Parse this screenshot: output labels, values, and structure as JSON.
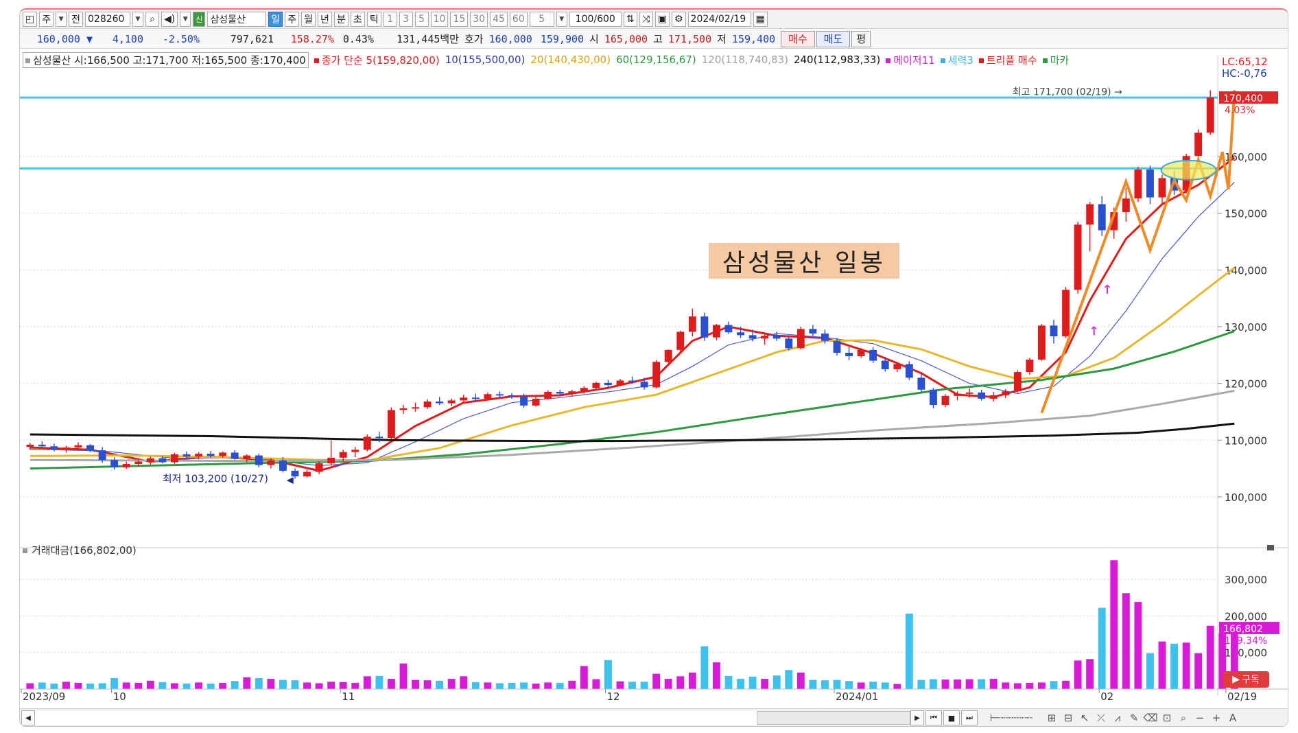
{
  "toolbar": {
    "type_label": "주",
    "prev_label": "전",
    "code": "028260",
    "new_badge": "신",
    "stock_name": "삼성물산",
    "periods": [
      "일",
      "주",
      "월",
      "년",
      "분",
      "초",
      "틱"
    ],
    "intervals": [
      "1",
      "3",
      "5",
      "10",
      "15",
      "30",
      "45",
      "60"
    ],
    "interval_value": "5",
    "count": "100/600",
    "date": "2024/02/19"
  },
  "pricebar": {
    "price": "160,000 ▼",
    "change": "4,100",
    "change_pct": "-2.50%",
    "volume": "797,621",
    "vol_ratio": "158.27%",
    "turnover": "0.43%",
    "amount": "131,445백만",
    "bid_label": "호가",
    "bid1": "160,000",
    "bid2": "159,900",
    "open_label": "시",
    "open": "165,000",
    "high_label": "고",
    "high": "171,500",
    "low_label": "저",
    "low": "159,400",
    "buy": "매수",
    "sell": "매도",
    "avg": "평"
  },
  "legend": {
    "stock": "삼성물산 시:166,500 고:171,700 저:165,500 종:170,400",
    "ma_title": "종가 단순 5(159,820,00)",
    "ma10": "10(155,500,00)",
    "ma20": "20(140,430,00)",
    "ma60": "60(129,156,67)",
    "ma120": "120(118,740,83)",
    "ma240": "240(112,983,33)",
    "major": "메이저11",
    "force": "세력3",
    "triple": "트리플 매수",
    "marker": "마카",
    "lc": "LC:65,12",
    "hc": "HC:-0,76"
  },
  "chart_data": {
    "type": "candlestick",
    "title": "삼성물산 일봉",
    "annotations": {
      "high": "최고 171,700 (02/19)",
      "low": "최저 103,200 (10/27)",
      "last_price": "170,400",
      "last_pct": "4.03%",
      "hlines": [
        170400,
        157900
      ]
    },
    "y_ticks": [
      "160,000",
      "150,000",
      "140,000",
      "130,000",
      "120,000",
      "110,000",
      "100,000"
    ],
    "y_tick_values": [
      160000,
      150000,
      140000,
      130000,
      120000,
      110000,
      100000
    ],
    "ylim": [
      92000,
      175500
    ],
    "x_labels": [
      "2023/09",
      "10",
      "11",
      "12",
      "2024/01",
      "02",
      "02/19"
    ],
    "x_label_index": [
      0,
      7,
      26,
      48,
      67,
      89,
      100
    ],
    "ohlc": [
      [
        108.8,
        109.5,
        108.3,
        109.2
      ],
      [
        109.2,
        109.8,
        108.8,
        108.9
      ],
      [
        108.9,
        109.4,
        108.0,
        108.4
      ],
      [
        108.4,
        109.0,
        107.8,
        108.7
      ],
      [
        108.7,
        109.6,
        108.2,
        109.1
      ],
      [
        109.1,
        109.3,
        107.9,
        108.2
      ],
      [
        108.2,
        108.8,
        106.0,
        106.5
      ],
      [
        106.5,
        107.0,
        104.8,
        105.2
      ],
      [
        105.2,
        106.2,
        104.9,
        105.8
      ],
      [
        105.8,
        106.6,
        105.3,
        106.2
      ],
      [
        106.2,
        107.1,
        105.7,
        106.8
      ],
      [
        106.8,
        107.2,
        105.9,
        106.1
      ],
      [
        106.1,
        107.8,
        105.8,
        107.5
      ],
      [
        107.5,
        108.0,
        106.8,
        107.1
      ],
      [
        107.1,
        107.9,
        106.6,
        107.6
      ],
      [
        107.6,
        108.1,
        106.9,
        107.2
      ],
      [
        107.2,
        108.0,
        106.9,
        107.8
      ],
      [
        107.8,
        108.2,
        106.5,
        106.7
      ],
      [
        106.7,
        107.5,
        106.1,
        107.3
      ],
      [
        107.3,
        107.6,
        105.2,
        105.6
      ],
      [
        105.6,
        106.8,
        105.0,
        106.4
      ],
      [
        106.4,
        107.0,
        104.3,
        104.6
      ],
      [
        104.6,
        105.0,
        103.2,
        103.6
      ],
      [
        103.6,
        104.8,
        103.4,
        104.4
      ],
      [
        104.4,
        106.3,
        104.0,
        105.9
      ],
      [
        105.9,
        110.0,
        105.5,
        106.9
      ],
      [
        106.9,
        108.3,
        106.2,
        107.9
      ],
      [
        107.9,
        108.8,
        107.0,
        108.3
      ],
      [
        108.3,
        111.0,
        108.0,
        110.6
      ],
      [
        110.6,
        111.5,
        109.6,
        110.4
      ],
      [
        110.4,
        115.8,
        110.1,
        115.3
      ],
      [
        115.3,
        116.2,
        114.6,
        115.6
      ],
      [
        115.6,
        116.6,
        115.0,
        115.8
      ],
      [
        115.8,
        117.2,
        115.5,
        116.8
      ],
      [
        116.8,
        117.6,
        116.2,
        116.5
      ],
      [
        116.5,
        117.3,
        116.0,
        117.0
      ],
      [
        117.0,
        118.0,
        116.7,
        117.5
      ],
      [
        117.5,
        118.2,
        116.9,
        117.3
      ],
      [
        117.3,
        118.4,
        117.0,
        118.1
      ],
      [
        118.1,
        118.6,
        117.4,
        117.9
      ],
      [
        117.9,
        118.3,
        117.3,
        117.7
      ],
      [
        117.7,
        118.2,
        115.7,
        116.1
      ],
      [
        116.1,
        117.6,
        115.9,
        117.3
      ],
      [
        117.3,
        118.8,
        117.1,
        118.5
      ],
      [
        118.5,
        118.9,
        117.8,
        118.2
      ],
      [
        118.2,
        118.9,
        117.7,
        118.6
      ],
      [
        118.6,
        119.5,
        118.2,
        119.2
      ],
      [
        119.2,
        120.3,
        118.8,
        120.1
      ],
      [
        120.1,
        120.6,
        119.3,
        119.7
      ],
      [
        119.7,
        120.8,
        119.5,
        120.5
      ],
      [
        120.5,
        121.2,
        119.9,
        120.3
      ],
      [
        120.3,
        121.0,
        118.9,
        119.3
      ],
      [
        119.3,
        124.1,
        119.1,
        123.8
      ],
      [
        123.8,
        126.0,
        123.5,
        125.9
      ],
      [
        125.9,
        129.3,
        125.6,
        129.1
      ],
      [
        129.1,
        133.2,
        128.3,
        131.8
      ],
      [
        131.8,
        132.5,
        127.5,
        128.1
      ],
      [
        128.1,
        130.5,
        127.6,
        130.3
      ],
      [
        130.3,
        130.9,
        128.7,
        129.0
      ],
      [
        129.0,
        130.0,
        128.0,
        128.5
      ],
      [
        128.5,
        129.5,
        127.4,
        127.9
      ],
      [
        127.9,
        129.0,
        126.8,
        128.4
      ],
      [
        128.4,
        129.1,
        127.5,
        127.9
      ],
      [
        127.9,
        128.5,
        125.8,
        126.2
      ],
      [
        126.2,
        130.0,
        126.0,
        129.6
      ],
      [
        129.6,
        130.3,
        128.4,
        128.8
      ],
      [
        128.8,
        129.5,
        127.0,
        127.5
      ],
      [
        127.5,
        128.0,
        124.9,
        125.4
      ],
      [
        125.4,
        126.5,
        124.1,
        124.8
      ],
      [
        124.8,
        126.2,
        124.5,
        125.9
      ],
      [
        125.9,
        126.4,
        123.6,
        124.0
      ],
      [
        124.0,
        124.7,
        122.1,
        122.5
      ],
      [
        122.5,
        123.8,
        122.0,
        123.4
      ],
      [
        123.4,
        123.9,
        120.6,
        121.0
      ],
      [
        121.0,
        121.8,
        118.4,
        118.9
      ],
      [
        118.9,
        119.2,
        115.6,
        116.2
      ],
      [
        116.2,
        118.1,
        115.8,
        117.8
      ],
      [
        117.8,
        118.6,
        117.0,
        118.2
      ],
      [
        118.2,
        119.1,
        117.5,
        118.4
      ],
      [
        118.4,
        118.9,
        117.0,
        117.3
      ],
      [
        117.3,
        118.5,
        116.8,
        117.9
      ],
      [
        117.9,
        119.0,
        117.4,
        118.6
      ],
      [
        118.6,
        122.3,
        118.4,
        122.0
      ],
      [
        122.0,
        124.5,
        121.5,
        124.2
      ],
      [
        124.2,
        130.5,
        124.0,
        130.2
      ],
      [
        130.2,
        131.2,
        127.0,
        128.3
      ],
      [
        128.3,
        137.0,
        128.0,
        136.5
      ],
      [
        136.5,
        148.5,
        135.8,
        148.0
      ],
      [
        148.0,
        152.0,
        143.3,
        151.6
      ],
      [
        151.6,
        153.0,
        146.0,
        147.0
      ],
      [
        147.0,
        151.0,
        145.5,
        150.2
      ],
      [
        150.2,
        154.5,
        148.5,
        152.6
      ],
      [
        152.6,
        158.2,
        152.0,
        157.7
      ],
      [
        157.7,
        158.4,
        151.6,
        152.8
      ],
      [
        152.8,
        156.8,
        151.8,
        156.2
      ],
      [
        156.2,
        157.5,
        153.2,
        154.0
      ],
      [
        154.0,
        160.5,
        153.5,
        160.1
      ],
      [
        160.1,
        164.8,
        159.0,
        164.2
      ],
      [
        164.2,
        171.7,
        163.8,
        170.4
      ]
    ],
    "ma_series": [
      {
        "name": "5",
        "color": "#e11c1c",
        "values_k": [
          [
            0,
            108.7
          ],
          [
            5,
            108.3
          ],
          [
            10,
            106.2
          ],
          [
            15,
            107.1
          ],
          [
            20,
            106.5
          ],
          [
            24,
            104.6
          ],
          [
            28,
            107.0
          ],
          [
            32,
            112.5
          ],
          [
            36,
            116.6
          ],
          [
            40,
            117.7
          ],
          [
            44,
            117.9
          ],
          [
            48,
            119.2
          ],
          [
            52,
            121.2
          ],
          [
            55,
            127.5
          ],
          [
            58,
            130.0
          ],
          [
            62,
            128.4
          ],
          [
            66,
            128.0
          ],
          [
            70,
            125.3
          ],
          [
            74,
            121.8
          ],
          [
            77,
            118.0
          ],
          [
            80,
            117.6
          ],
          [
            83,
            119.3
          ],
          [
            86,
            125.5
          ],
          [
            88,
            134.6
          ],
          [
            91,
            145.5
          ],
          [
            94,
            151.6
          ],
          [
            97,
            155.0
          ],
          [
            100,
            159.8
          ]
        ]
      },
      {
        "name": "10",
        "color": "#4a5bd4",
        "values_k": [
          [
            0,
            108.4
          ],
          [
            6,
            108.1
          ],
          [
            12,
            106.8
          ],
          [
            18,
            106.9
          ],
          [
            24,
            105.5
          ],
          [
            28,
            106.0
          ],
          [
            32,
            109.7
          ],
          [
            36,
            113.8
          ],
          [
            40,
            116.6
          ],
          [
            44,
            117.5
          ],
          [
            48,
            118.5
          ],
          [
            52,
            119.8
          ],
          [
            55,
            123.0
          ],
          [
            58,
            126.8
          ],
          [
            62,
            128.8
          ],
          [
            66,
            128.1
          ],
          [
            70,
            127.0
          ],
          [
            74,
            124.0
          ],
          [
            78,
            120.0
          ],
          [
            82,
            118.2
          ],
          [
            85,
            119.5
          ],
          [
            88,
            124.8
          ],
          [
            91,
            132.8
          ],
          [
            94,
            142.0
          ],
          [
            97,
            149.4
          ],
          [
            100,
            155.5
          ]
        ]
      },
      {
        "name": "20",
        "color": "#e8b72a",
        "values_k": [
          [
            0,
            107.2
          ],
          [
            8,
            107.3
          ],
          [
            16,
            107.0
          ],
          [
            24,
            106.5
          ],
          [
            28,
            106.4
          ],
          [
            34,
            108.6
          ],
          [
            40,
            112.6
          ],
          [
            46,
            115.8
          ],
          [
            52,
            118.0
          ],
          [
            58,
            122.5
          ],
          [
            62,
            125.5
          ],
          [
            66,
            127.5
          ],
          [
            70,
            127.6
          ],
          [
            74,
            126.0
          ],
          [
            78,
            123.0
          ],
          [
            82,
            120.8
          ],
          [
            86,
            121.3
          ],
          [
            90,
            124.5
          ],
          [
            94,
            130.5
          ],
          [
            97,
            135.5
          ],
          [
            100,
            140.4
          ]
        ]
      },
      {
        "name": "60",
        "color": "#2a9a3c",
        "values_k": [
          [
            0,
            105.0
          ],
          [
            10,
            105.5
          ],
          [
            20,
            106.0
          ],
          [
            28,
            106.3
          ],
          [
            36,
            107.5
          ],
          [
            44,
            109.3
          ],
          [
            52,
            111.4
          ],
          [
            60,
            114.0
          ],
          [
            68,
            116.5
          ],
          [
            76,
            119.0
          ],
          [
            84,
            120.6
          ],
          [
            90,
            122.6
          ],
          [
            95,
            125.6
          ],
          [
            100,
            129.2
          ]
        ]
      },
      {
        "name": "120",
        "color": "#a9a9a9",
        "values_k": [
          [
            0,
            106.5
          ],
          [
            20,
            106.3
          ],
          [
            30,
            106.5
          ],
          [
            40,
            107.4
          ],
          [
            50,
            108.7
          ],
          [
            60,
            110.1
          ],
          [
            70,
            111.7
          ],
          [
            80,
            113.0
          ],
          [
            88,
            114.3
          ],
          [
            94,
            116.4
          ],
          [
            100,
            118.7
          ]
        ]
      },
      {
        "name": "240",
        "color": "#111111",
        "values_k": [
          [
            0,
            111.0
          ],
          [
            15,
            110.7
          ],
          [
            30,
            110.0
          ],
          [
            45,
            109.8
          ],
          [
            60,
            110.0
          ],
          [
            75,
            110.4
          ],
          [
            85,
            110.8
          ],
          [
            92,
            111.3
          ],
          [
            96,
            112.0
          ],
          [
            100,
            112.9
          ]
        ]
      }
    ],
    "volume": {
      "title": "거래대금(166,802,00)",
      "y_ticks": [
        "300,000",
        "200,000",
        "100,000"
      ],
      "y_tick_values": [
        300000,
        200000,
        100000
      ],
      "last": "166,802",
      "last_pct": "109.34%",
      "values_k": [
        16,
        18,
        15,
        20,
        17,
        15,
        16,
        30,
        18,
        17,
        23,
        19,
        16,
        15,
        18,
        15,
        17,
        22,
        32,
        30,
        28,
        25,
        24,
        18,
        16,
        20,
        19,
        17,
        35,
        36,
        28,
        70,
        25,
        24,
        23,
        28,
        35,
        19,
        18,
        16,
        17,
        18,
        15,
        18,
        17,
        23,
        63,
        27,
        79,
        21,
        20,
        20,
        42,
        28,
        35,
        45,
        117,
        73,
        36,
        28,
        34,
        28,
        37,
        52,
        45,
        25,
        24,
        25,
        22,
        18,
        20,
        18,
        14,
        206,
        25,
        27,
        26,
        26,
        27,
        27,
        28,
        18,
        16,
        17,
        18,
        22,
        23,
        78,
        82,
        222,
        352,
        262,
        238,
        98,
        130,
        124,
        127,
        98,
        173,
        153,
        163
      ],
      "up_index_from": 85
    }
  },
  "bottom": {
    "subscribe": "구독"
  }
}
